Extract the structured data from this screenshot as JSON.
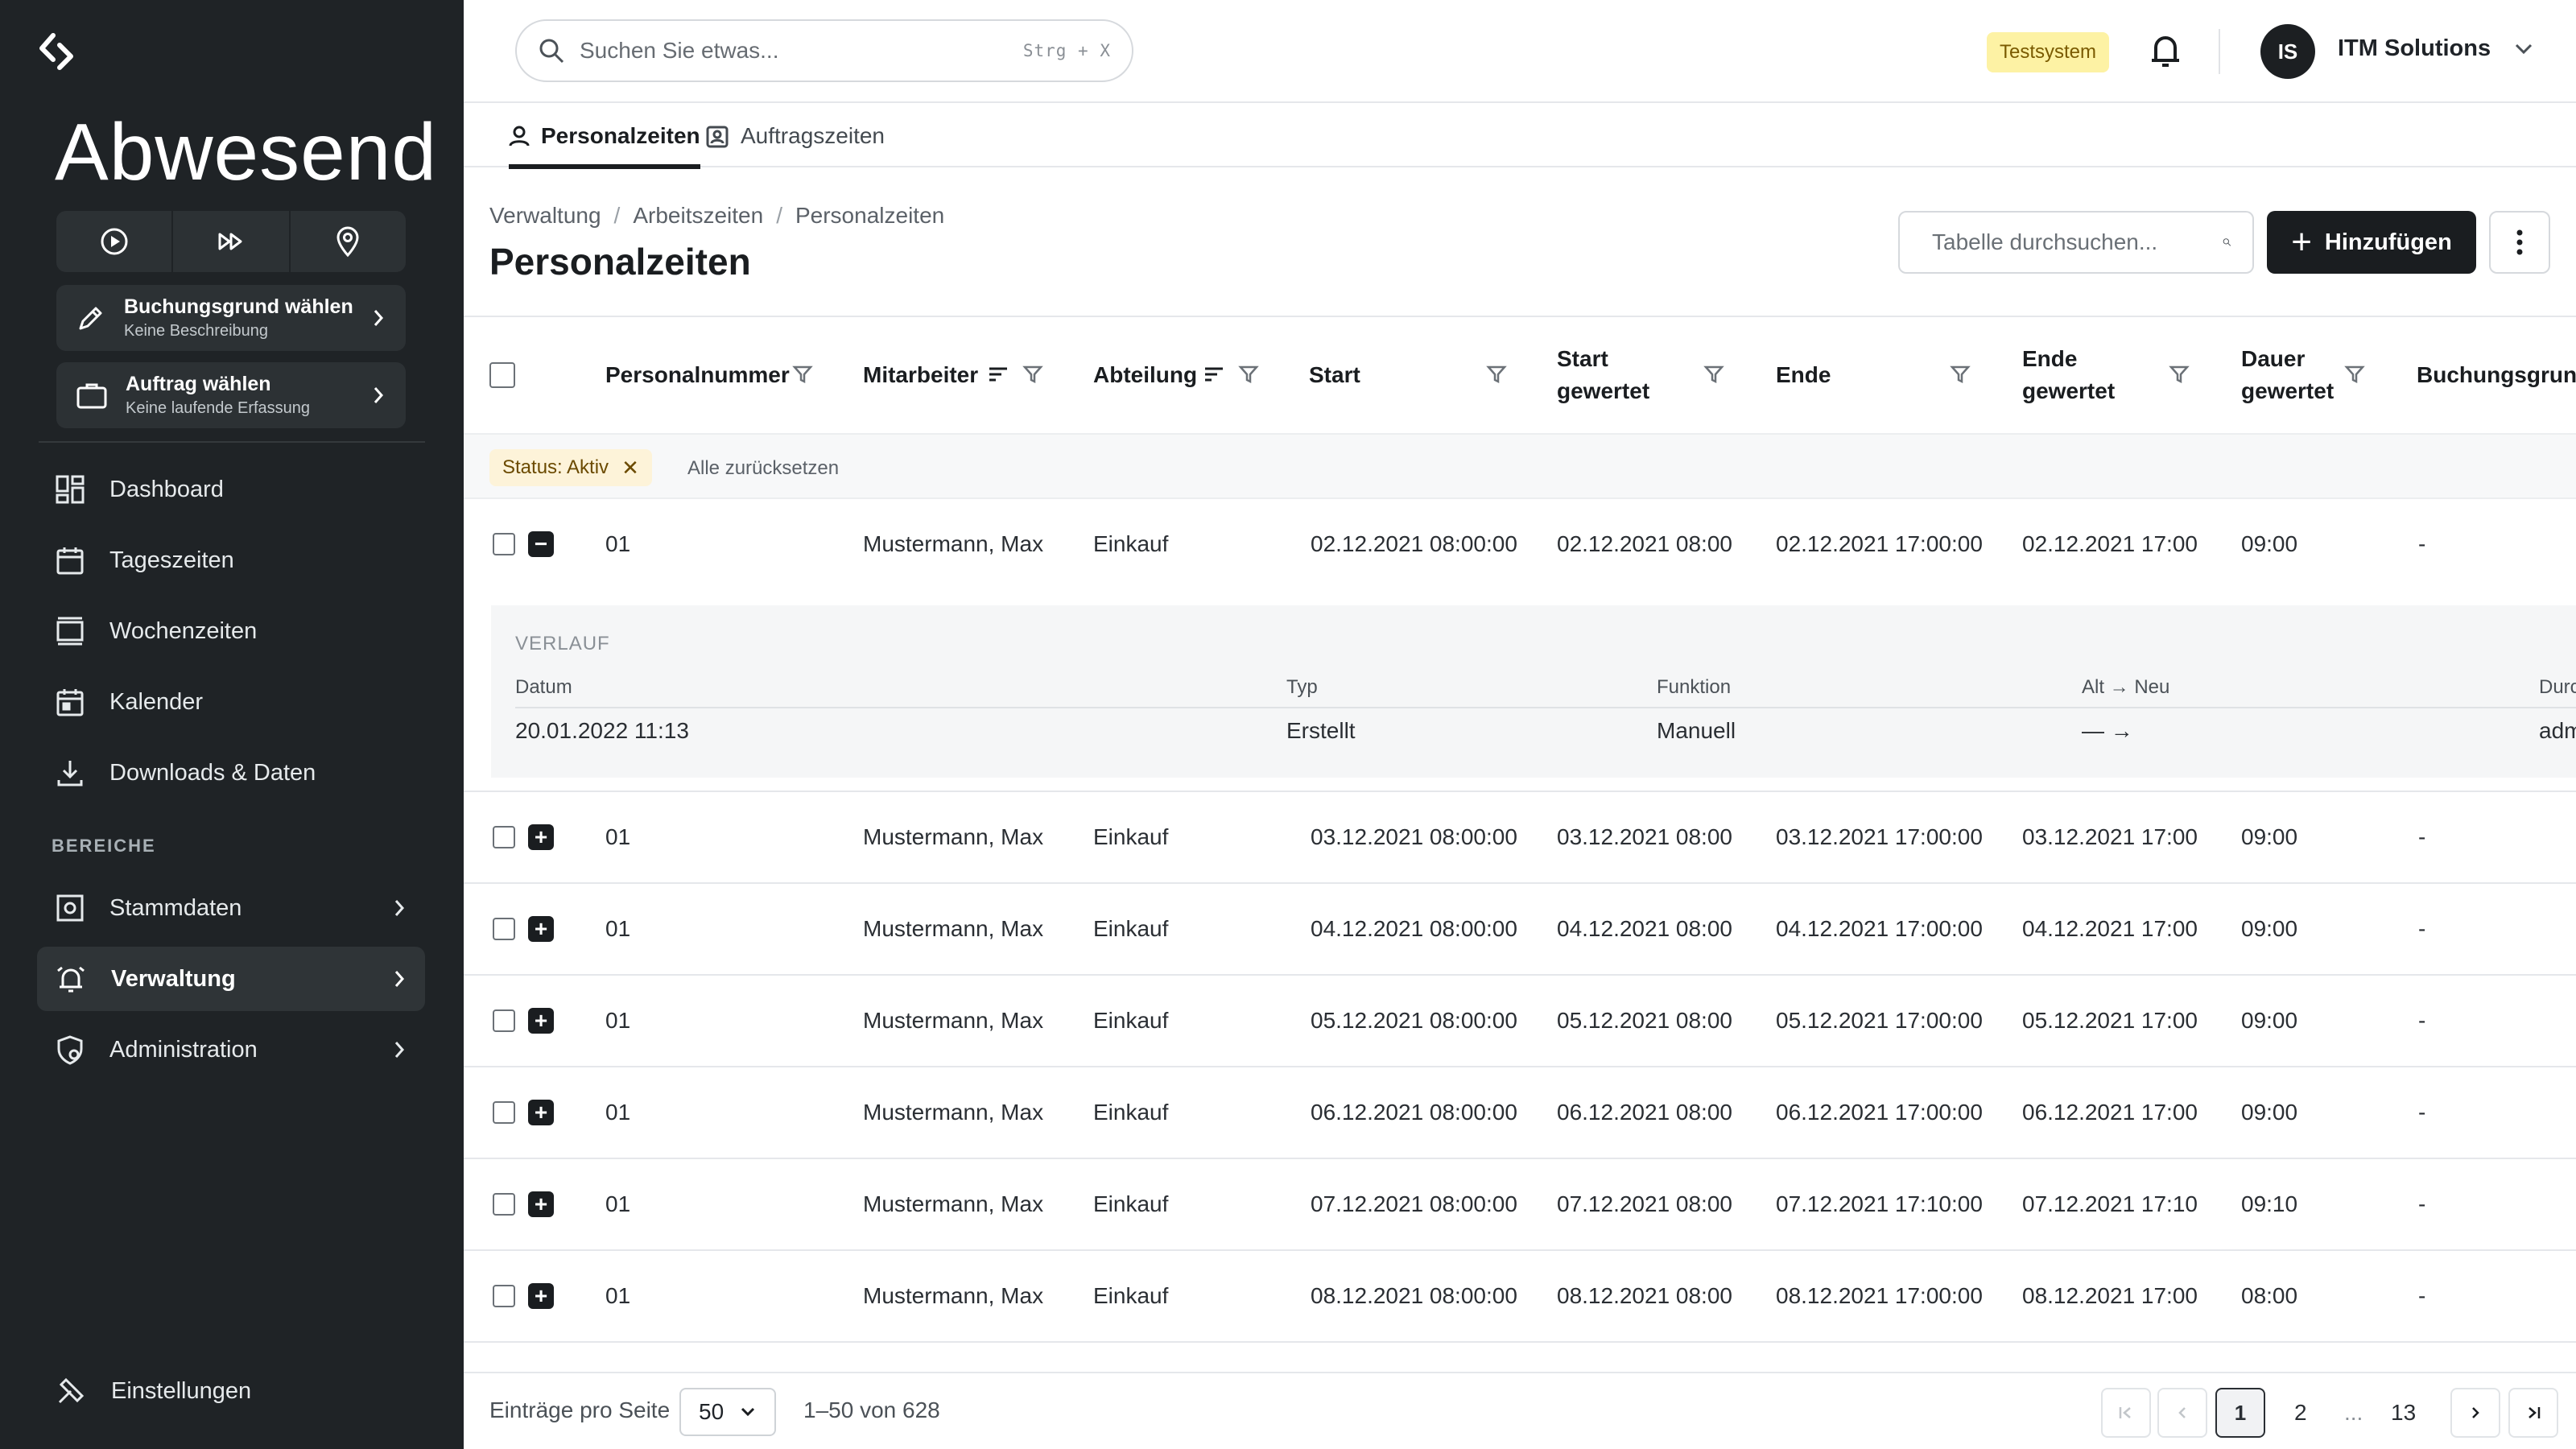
{
  "sidebar": {
    "status_title": "Abwesend",
    "booking_reason": {
      "title": "Buchungsgrund wählen",
      "subtitle": "Keine Beschreibung"
    },
    "order": {
      "title": "Auftrag wählen",
      "subtitle": "Keine laufende Erfassung"
    },
    "nav": [
      "Dashboard",
      "Tageszeiten",
      "Wochenzeiten",
      "Kalender",
      "Downloads & Daten"
    ],
    "section_label": "BEREICHE",
    "areas": [
      "Stammdaten",
      "Verwaltung",
      "Administration"
    ],
    "settings": "Einstellungen"
  },
  "topbar": {
    "search_placeholder": "Suchen Sie etwas...",
    "shortcut": "Strg + X",
    "badge": "Testsystem",
    "avatar_initials": "IS",
    "account_name": "ITM Solutions"
  },
  "tabs": [
    "Personalzeiten",
    "Auftragszeiten"
  ],
  "breadcrumb": [
    "Verwaltung",
    "Arbeitszeiten",
    "Personalzeiten"
  ],
  "page_title": "Personalzeiten",
  "table_search_placeholder": "Tabelle durchsuchen...",
  "add_button": "Hinzufügen",
  "columns": {
    "personalnummer": "Personalnummer",
    "mitarbeiter": "Mitarbeiter",
    "abteilung": "Abteilung",
    "start": "Start",
    "start_gewertet_1": "Start",
    "start_gewertet_2": "gewertet",
    "ende": "Ende",
    "ende_gewertet_1": "Ende",
    "ende_gewertet_2": "gewertet",
    "dauer_1": "Dauer",
    "dauer_2": "gewertet",
    "buchungsgrund": "Buchungsgrund"
  },
  "filter": {
    "chip": "Status: Aktiv",
    "reset": "Alle zurücksetzen"
  },
  "rows": [
    {
      "nr": "01",
      "name": "Mustermann, Max",
      "abt": "Einkauf",
      "start": "02.12.2021 08:00:00",
      "start_g": "02.12.2021 08:00",
      "ende": "02.12.2021 17:00:00",
      "ende_g": "02.12.2021 17:00",
      "dauer": "09:00",
      "grund": "-"
    },
    {
      "nr": "01",
      "name": "Mustermann, Max",
      "abt": "Einkauf",
      "start": "03.12.2021 08:00:00",
      "start_g": "03.12.2021 08:00",
      "ende": "03.12.2021 17:00:00",
      "ende_g": "03.12.2021 17:00",
      "dauer": "09:00",
      "grund": "-"
    },
    {
      "nr": "01",
      "name": "Mustermann, Max",
      "abt": "Einkauf",
      "start": "04.12.2021 08:00:00",
      "start_g": "04.12.2021 08:00",
      "ende": "04.12.2021 17:00:00",
      "ende_g": "04.12.2021 17:00",
      "dauer": "09:00",
      "grund": "-"
    },
    {
      "nr": "01",
      "name": "Mustermann, Max",
      "abt": "Einkauf",
      "start": "05.12.2021 08:00:00",
      "start_g": "05.12.2021 08:00",
      "ende": "05.12.2021 17:00:00",
      "ende_g": "05.12.2021 17:00",
      "dauer": "09:00",
      "grund": "-"
    },
    {
      "nr": "01",
      "name": "Mustermann, Max",
      "abt": "Einkauf",
      "start": "06.12.2021 08:00:00",
      "start_g": "06.12.2021 08:00",
      "ende": "06.12.2021 17:00:00",
      "ende_g": "06.12.2021 17:00",
      "dauer": "09:00",
      "grund": "-"
    },
    {
      "nr": "01",
      "name": "Mustermann, Max",
      "abt": "Einkauf",
      "start": "07.12.2021 08:00:00",
      "start_g": "07.12.2021 08:00",
      "ende": "07.12.2021 17:10:00",
      "ende_g": "07.12.2021 17:10",
      "dauer": "09:10",
      "grund": "-"
    },
    {
      "nr": "01",
      "name": "Mustermann, Max",
      "abt": "Einkauf",
      "start": "08.12.2021 08:00:00",
      "start_g": "08.12.2021 08:00",
      "ende": "08.12.2021 17:00:00",
      "ende_g": "08.12.2021 17:00",
      "dauer": "08:00",
      "grund": "-"
    }
  ],
  "detail": {
    "title": "VERLAUF",
    "headers": {
      "datum": "Datum",
      "typ": "Typ",
      "funktion": "Funktion",
      "alt_neu": "Alt → Neu",
      "durch": "Durch"
    },
    "values": {
      "datum": "20.01.2022 11:13",
      "typ": "Erstellt",
      "funktion": "Manuell",
      "alt_neu": "— →",
      "durch": "admin"
    }
  },
  "footer": {
    "per_page_label": "Einträge pro Seite",
    "per_page": "50",
    "per_page_options": [
      "50"
    ],
    "range": "1–50 von 628",
    "pages": [
      "1",
      "2",
      "...",
      "13"
    ]
  },
  "colors": {
    "sidebar": "#1f2326",
    "accent": "#1a1d20",
    "badge_bg": "#fdf2a4"
  }
}
